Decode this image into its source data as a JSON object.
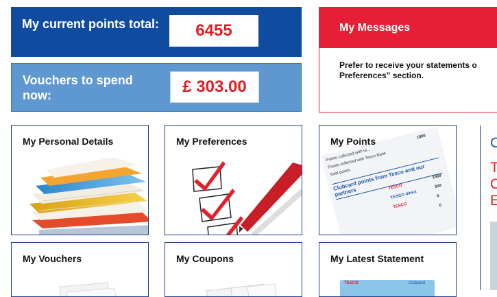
{
  "points": {
    "label": "My current points total:",
    "value": "6455"
  },
  "vouchers": {
    "label": "Vouchers to spend now:",
    "value": "£ 303.00"
  },
  "messages": {
    "title": "My Messages",
    "text_line1": "Prefer to receive your statements o",
    "text_line2": "Preferences\" section."
  },
  "tiles": [
    {
      "title": "My Personal Details",
      "icon": "folders-icon"
    },
    {
      "title": "My Preferences",
      "icon": "checklist-icon"
    },
    {
      "title": "My Points",
      "icon": "points-statement-icon",
      "card_heading": "Clubcard points from Tesco and our partners",
      "rows": [
        {
          "label": "Points collected with re...",
          "value": "1800"
        },
        {
          "label": "Points collected with Tesco Bank",
          "value": ""
        },
        {
          "label": "Total points",
          "value": ""
        }
      ],
      "partner_rows": [
        {
          "label": "TESCO",
          "value": "1500"
        },
        {
          "label": "TESCO direct",
          "value": "300"
        },
        {
          "label": "TESCO",
          "value": "0"
        },
        {
          "label": "",
          "value": "0"
        }
      ]
    },
    {
      "title": "My Vouchers",
      "icon": "vouchers-icon"
    },
    {
      "title": "My Coupons",
      "icon": "coupons-icon"
    },
    {
      "title": "My Latest Statement",
      "icon": "statement-icon",
      "card_brand": "TESCO",
      "card_text": "Clubcard"
    }
  ],
  "promo": {
    "line1": "C",
    "line2": "T",
    "line3": "C",
    "line4": "E"
  },
  "colors": {
    "navy": "#0f4c9f",
    "light_blue": "#5f97d0",
    "red": "#e61f36",
    "value_red": "#e51d24"
  }
}
